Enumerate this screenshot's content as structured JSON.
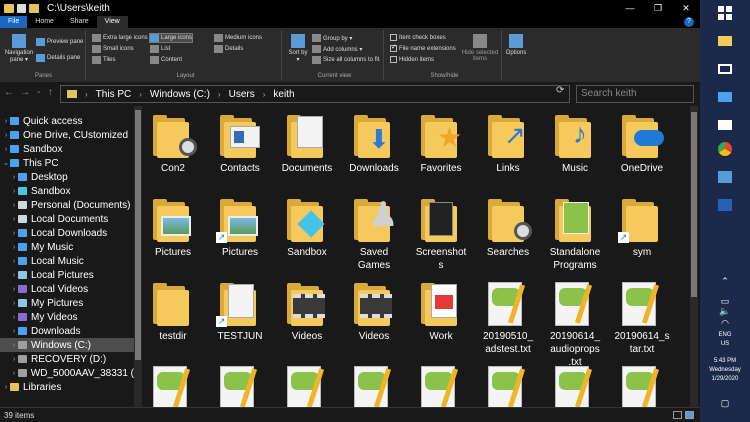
{
  "window": {
    "title_path": "C:\\Users\\keith",
    "controls": {
      "minimize": "—",
      "maximize": "❐",
      "close": "✕"
    }
  },
  "ribbon_tabs": [
    {
      "label": "File"
    },
    {
      "label": "Home"
    },
    {
      "label": "Share"
    },
    {
      "label": "View"
    }
  ],
  "ribbon": {
    "panes": {
      "label": "Panes",
      "navigation_pane": "Navigation pane ▾",
      "preview_pane": "Preview pane",
      "details_pane": "Details pane"
    },
    "layout": {
      "label": "Layout",
      "options": [
        "Extra large icons",
        "Large icons",
        "Medium icons",
        "Small icons",
        "List",
        "Details",
        "Tiles",
        "Content"
      ],
      "selected": "Large icons"
    },
    "current_view": {
      "label": "Current view",
      "sort_by": "Sort by ▾",
      "group_by": "Group by ▾",
      "add_columns": "Add columns ▾",
      "size_columns": "Size all columns to fit"
    },
    "show_hide": {
      "label": "Show/hide",
      "item_check_boxes": "Item check boxes",
      "file_name_extensions": "File name extensions",
      "hidden_items": "Hidden items",
      "hide_selected": "Hide selected items",
      "options": "Options"
    }
  },
  "address": {
    "crumbs": [
      "This PC",
      "Windows (C:)",
      "Users",
      "keith"
    ],
    "search_placeholder": "Search keith"
  },
  "nav_pane": {
    "items": [
      {
        "label": "Quick access",
        "icon": "star-icon",
        "color": "#4aa3f0",
        "level": 0,
        "expander": "›"
      },
      {
        "label": "One Drive, CUstomized",
        "icon": "cloud-icon",
        "color": "#4aa3f0",
        "level": 0,
        "expander": "›"
      },
      {
        "label": "Sandbox",
        "icon": "cloud-icon",
        "color": "#4aa3f0",
        "level": 0,
        "expander": "›"
      },
      {
        "label": "This PC",
        "icon": "pc-icon",
        "color": "#4aa3f0",
        "level": 0,
        "expander": "⌄"
      },
      {
        "label": "Desktop",
        "icon": "desktop-icon",
        "color": "#4aa3f0",
        "level": 1,
        "expander": "›"
      },
      {
        "label": "Sandbox",
        "icon": "cube-icon",
        "color": "#4ac6e0",
        "level": 1,
        "expander": "›"
      },
      {
        "label": "Personal (Documents)",
        "icon": "documents-icon",
        "color": "#cfd8dc",
        "level": 1,
        "expander": "›"
      },
      {
        "label": "Local Documents",
        "icon": "documents-icon",
        "color": "#cfd8dc",
        "level": 1,
        "expander": "›"
      },
      {
        "label": "Local Downloads",
        "icon": "download-icon",
        "color": "#4aa3f0",
        "level": 1,
        "expander": "›"
      },
      {
        "label": "My Music",
        "icon": "music-icon",
        "color": "#4aa3f0",
        "level": 1,
        "expander": "›"
      },
      {
        "label": "Local Music",
        "icon": "music-icon",
        "color": "#4aa3f0",
        "level": 1,
        "expander": "›"
      },
      {
        "label": "Local Pictures",
        "icon": "pictures-icon",
        "color": "#8ec5e8",
        "level": 1,
        "expander": "›"
      },
      {
        "label": "Local Videos",
        "icon": "videos-icon",
        "color": "#8a6ccf",
        "level": 1,
        "expander": "›"
      },
      {
        "label": "My Pictures",
        "icon": "pictures-icon",
        "color": "#8ec5e8",
        "level": 1,
        "expander": "›"
      },
      {
        "label": "My Videos",
        "icon": "videos-icon",
        "color": "#8a6ccf",
        "level": 1,
        "expander": "›"
      },
      {
        "label": "Downloads",
        "icon": "download-icon",
        "color": "#4aa3f0",
        "level": 1,
        "expander": "›"
      },
      {
        "label": "Windows (C:)",
        "icon": "drive-icon",
        "color": "#9e9e9e",
        "level": 1,
        "expander": "›",
        "selected": true
      },
      {
        "label": "RECOVERY (D:)",
        "icon": "drive-icon",
        "color": "#9e9e9e",
        "level": 1,
        "expander": "›"
      },
      {
        "label": "WD_5000AAV_38331 (",
        "icon": "drive-icon",
        "color": "#9e9e9e",
        "level": 1,
        "expander": "›"
      },
      {
        "label": "Libraries",
        "icon": "library-icon",
        "color": "#e8c25a",
        "level": 0,
        "expander": "›"
      }
    ]
  },
  "files": [
    {
      "name": "Con2",
      "kind": "folder",
      "overlay": "magnifier"
    },
    {
      "name": "Contacts",
      "kind": "folder",
      "overlay": "contact-card"
    },
    {
      "name": "Documents",
      "kind": "folder",
      "overlay": "document"
    },
    {
      "name": "Downloads",
      "kind": "folder",
      "overlay": "download-arrow"
    },
    {
      "name": "Favorites",
      "kind": "folder",
      "overlay": "star"
    },
    {
      "name": "Links",
      "kind": "folder",
      "overlay": "link-arrow"
    },
    {
      "name": "Music",
      "kind": "folder",
      "overlay": "music-note"
    },
    {
      "name": "OneDrive",
      "kind": "folder",
      "overlay": "cloud"
    },
    {
      "name": "Pictures",
      "kind": "folder",
      "overlay": "picture"
    },
    {
      "name": "Pictures",
      "kind": "folder",
      "overlay": "picture-shortcut"
    },
    {
      "name": "Sandbox",
      "kind": "folder",
      "overlay": "cube"
    },
    {
      "name": "Saved Games",
      "kind": "folder",
      "overlay": "chess-piece"
    },
    {
      "name": "Screenshots",
      "kind": "folder",
      "overlay": "screenshot"
    },
    {
      "name": "Searches",
      "kind": "folder",
      "overlay": "magnifier"
    },
    {
      "name": "Standalone Programs",
      "kind": "folder",
      "overlay": "programs"
    },
    {
      "name": "sym",
      "kind": "folder",
      "overlay": "shortcut"
    },
    {
      "name": "testdir",
      "kind": "folder",
      "overlay": "none"
    },
    {
      "name": "TESTJUN",
      "kind": "folder",
      "overlay": "documents-shortcut"
    },
    {
      "name": "Videos",
      "kind": "folder",
      "overlay": "film"
    },
    {
      "name": "Videos",
      "kind": "folder",
      "overlay": "film"
    },
    {
      "name": "Work",
      "kind": "folder",
      "overlay": "pdf"
    },
    {
      "name": "20190510_adstest.txt",
      "kind": "notepad"
    },
    {
      "name": "20190614_audioprops.txt",
      "kind": "notepad"
    },
    {
      "name": "20190614_star.txt",
      "kind": "notepad"
    },
    {
      "name": "",
      "kind": "notepad"
    },
    {
      "name": "",
      "kind": "notepad"
    },
    {
      "name": "",
      "kind": "notepad"
    },
    {
      "name": "",
      "kind": "notepad"
    },
    {
      "name": "",
      "kind": "notepad"
    },
    {
      "name": "",
      "kind": "notepad"
    },
    {
      "name": "",
      "kind": "notepad"
    },
    {
      "name": "",
      "kind": "notepad"
    }
  ],
  "file_name_display": [
    "Con2",
    "Contacts",
    "Documents",
    "Downloads",
    "Favorites",
    "Links",
    "Music",
    "OneDrive",
    "Pictures",
    "Pictures",
    "Sandbox",
    "Saved\nGames",
    "Screenshot\ns",
    "Searches",
    "Standalone\nPrograms",
    "sym",
    "testdir",
    "TESTJUN",
    "Videos",
    "Videos",
    "Work",
    "20190510_\nadstest.txt",
    "20190614_\naudioprops\n.txt",
    "20190614_s\ntar.txt",
    "",
    "",
    "",
    "",
    "",
    "",
    "",
    ""
  ],
  "status": {
    "item_count": "39 items"
  },
  "taskbar": {
    "tray": {
      "lang": "ENG",
      "region": "US",
      "time": "5:43 PM",
      "day": "Wednesday",
      "date": "1/29/2020"
    }
  },
  "colors": {
    "folder_front": "#f5c95c",
    "folder_back": "#d9a93a",
    "accent": "#1a66c2",
    "taskbar": "#1b2a4a"
  }
}
